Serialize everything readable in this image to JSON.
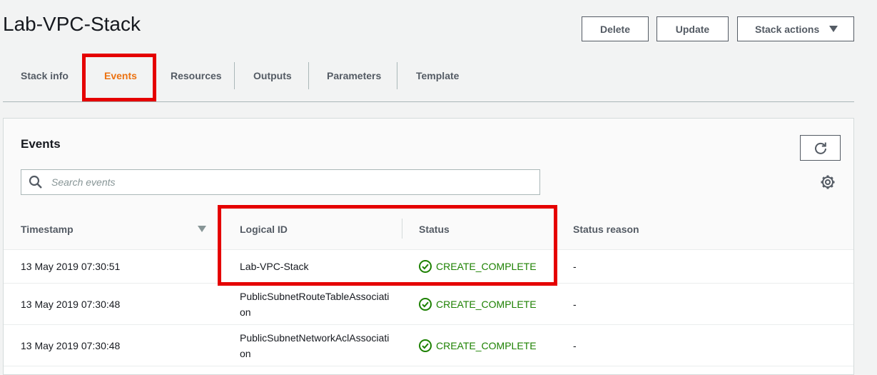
{
  "page": {
    "title": "Lab-VPC-Stack"
  },
  "header_buttons": {
    "delete": "Delete",
    "update": "Update",
    "stack_actions": "Stack actions"
  },
  "tabs": [
    {
      "label": "Stack info"
    },
    {
      "label": "Events",
      "active": true
    },
    {
      "label": "Resources"
    },
    {
      "label": "Outputs"
    },
    {
      "label": "Parameters"
    },
    {
      "label": "Template"
    }
  ],
  "events": {
    "title": "Events",
    "search_placeholder": "Search events",
    "columns": {
      "timestamp": "Timestamp",
      "logical_id": "Logical ID",
      "status": "Status",
      "status_reason": "Status reason"
    },
    "rows": [
      {
        "timestamp": "13 May 2019 07:30:51",
        "logical_id": "Lab-VPC-Stack",
        "status": "CREATE_COMPLETE",
        "status_reason": "-"
      },
      {
        "timestamp": "13 May 2019 07:30:48",
        "logical_id": "PublicSubnetRouteTableAssociation",
        "status": "CREATE_COMPLETE",
        "status_reason": "-"
      },
      {
        "timestamp": "13 May 2019 07:30:48",
        "logical_id": "PublicSubnetNetworkAclAssociation",
        "status": "CREATE_COMPLETE",
        "status_reason": "-"
      }
    ]
  },
  "colors": {
    "accent": "#ec7211",
    "success": "#1d8102",
    "highlight": "#e50000"
  },
  "icons": {
    "refresh": "refresh-icon",
    "settings": "gear-icon",
    "search": "search-icon",
    "status": "check-circle-icon"
  }
}
